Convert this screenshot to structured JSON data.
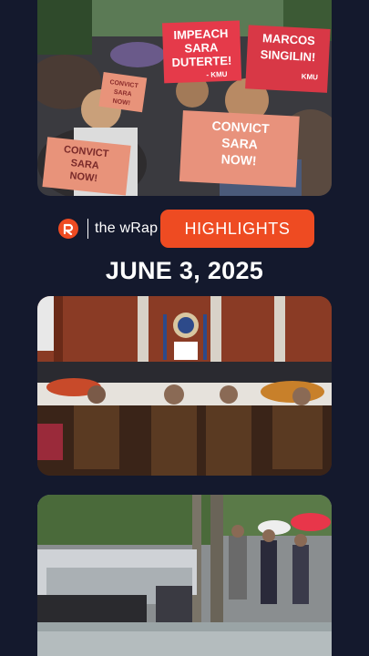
{
  "brand": {
    "name": "the wRap",
    "badge": "HIGHLIGHTS"
  },
  "date": "JUNE 3, 2025",
  "photos": {
    "protest": {
      "sign_impeach": [
        "IMPEACH",
        "SARA",
        "DUTERTE!"
      ],
      "sign_impeach_org": "- KMU",
      "sign_marcos": [
        "MARCOS",
        "SINGILIN!"
      ],
      "sign_marcos_org": "KMU",
      "sign_convict_main": [
        "CONVICT",
        "SARA",
        "NOW!"
      ],
      "sign_convict_left": [
        "CONVICT",
        "SARA",
        "NOW!"
      ],
      "sign_small": [
        "CONVICT",
        "SARA",
        "NOW!"
      ]
    }
  },
  "colors": {
    "background": "#14192d",
    "accent": "#ee4b22",
    "text": "#ffffff"
  }
}
